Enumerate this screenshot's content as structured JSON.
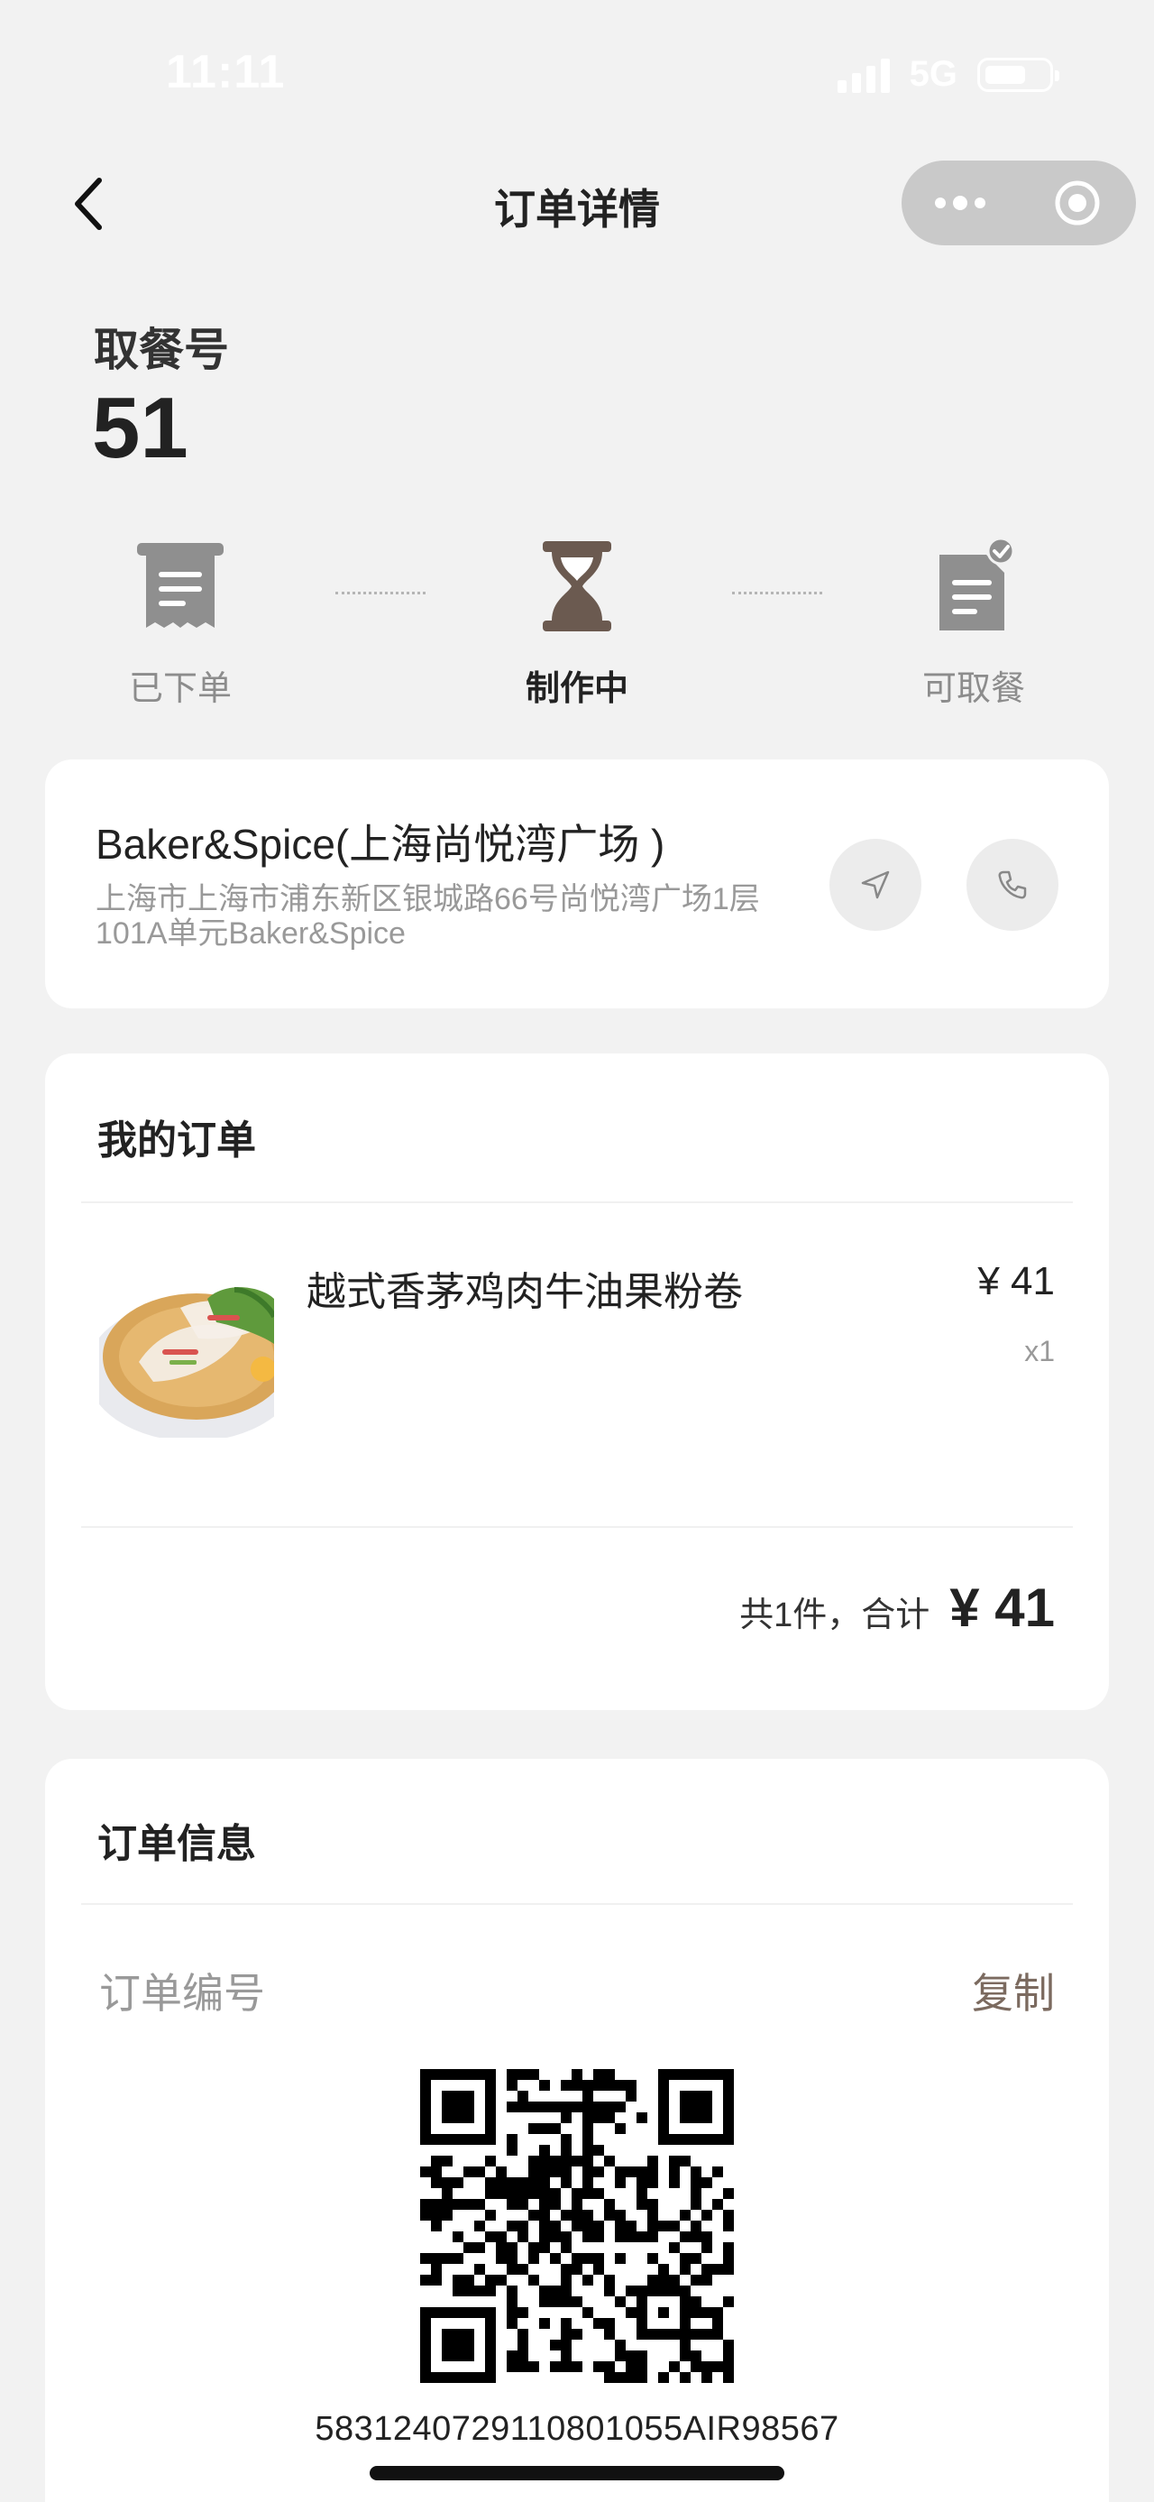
{
  "status_bar": {
    "time": "11:11",
    "network": "5G"
  },
  "nav": {
    "title": "订单详情"
  },
  "pickup": {
    "label": "取餐号",
    "number": "51"
  },
  "progress": {
    "steps": [
      {
        "label": "已下单",
        "icon": "receipt-icon",
        "state": "done"
      },
      {
        "label": "制作中",
        "icon": "hourglass-icon",
        "state": "active"
      },
      {
        "label": "可取餐",
        "icon": "ready-document-icon",
        "state": "pending"
      }
    ]
  },
  "store": {
    "name": "Baker&Spice(上海尚悦湾广场 )",
    "address": "上海市上海市浦东新区银城路66号尚悦湾广场1层101A单元Baker&Spice",
    "navigate_icon": "navigation-arrow-icon",
    "call_icon": "phone-icon"
  },
  "order": {
    "title": "我的订单",
    "items": [
      {
        "name": "越式香茅鸡肉牛油果粉卷",
        "price": "¥ 41",
        "qty": "x1"
      }
    ],
    "total_text": "共1件，合计",
    "total_amount": "¥ 41"
  },
  "info": {
    "title": "订单信息",
    "order_no_label": "订单编号",
    "copy_label": "复制",
    "order_no": "5831240729110801055AIR98567"
  },
  "colors": {
    "background": "#f2f2f2",
    "accent_brown": "#7b6a5f",
    "active_icon": "#6b5a50",
    "inactive_icon": "#8f8f8f"
  }
}
